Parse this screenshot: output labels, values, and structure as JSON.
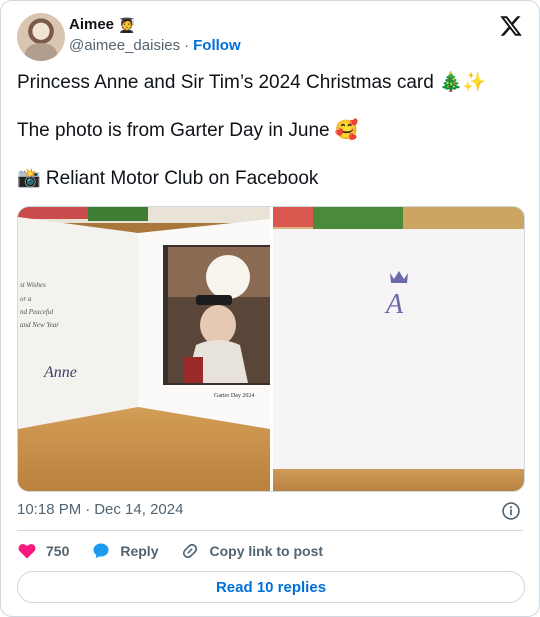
{
  "author": {
    "display_name": "Aimee",
    "name_emoji": "🧑‍🎓",
    "handle": "@aimee_daisies",
    "separator": "·",
    "follow_label": "Follow"
  },
  "tweet": {
    "line1": "Princess Anne and Sir Tim’s 2024 Christmas card 🎄✨",
    "line2": "The photo is from Garter Day in June 🥰",
    "line3": "📸 Reliant Motor Club on Facebook"
  },
  "media": {
    "card_greeting_lines": [
      "st Wishes",
      "or a",
      "nd Peaceful",
      "and New Year"
    ],
    "card_signature": "Anne",
    "photo_caption": "Garter Day 2024",
    "monogram": "A"
  },
  "meta": {
    "time": "10:18 PM",
    "separator": "·",
    "date": "Dec 14, 2024"
  },
  "actions": {
    "like_count": "750",
    "reply_label": "Reply",
    "copy_label": "Copy link to post"
  },
  "read_replies_label": "Read 10 replies",
  "colors": {
    "accent": "#006fd6",
    "like": "#f91880",
    "text_secondary": "#536471",
    "border": "#cfd9de"
  }
}
